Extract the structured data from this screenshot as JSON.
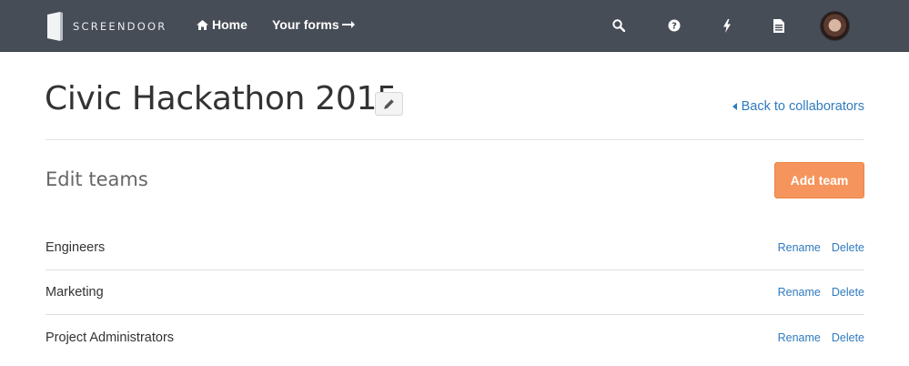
{
  "nav": {
    "brand": "SCREENDOOR",
    "links": [
      {
        "label": "Home",
        "icon": "home-icon"
      },
      {
        "label": "Your forms",
        "icon": "arrow-right-icon"
      }
    ],
    "icons": [
      "search-icon",
      "help-icon",
      "lightning-icon",
      "document-icon"
    ],
    "avatar_icon": "user-avatar"
  },
  "header": {
    "title": "Civic Hackathon 2015",
    "edit_icon": "pencil-icon",
    "back_link": "Back to collaborators"
  },
  "teams_section": {
    "heading": "Edit teams",
    "add_button": "Add team",
    "teams": [
      {
        "name": "Engineers",
        "rename": "Rename",
        "delete": "Delete"
      },
      {
        "name": "Marketing",
        "rename": "Rename",
        "delete": "Delete"
      },
      {
        "name": "Project Administrators",
        "rename": "Rename",
        "delete": "Delete"
      }
    ]
  },
  "colors": {
    "navbar": "#474d57",
    "accent_button": "#f5955d",
    "link": "#2f7bbf"
  }
}
